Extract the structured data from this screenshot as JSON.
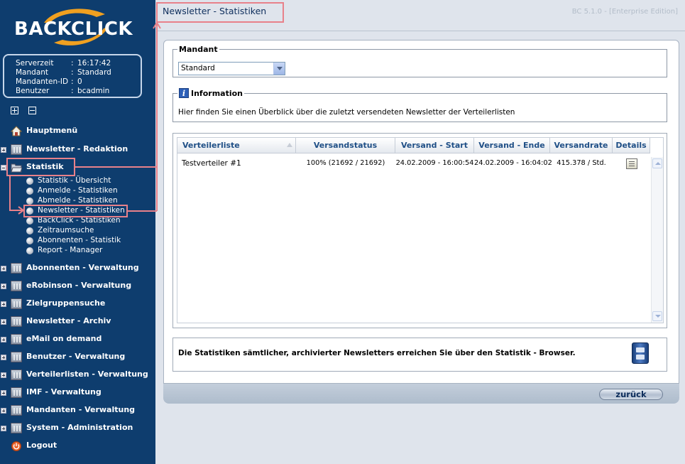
{
  "app": {
    "logo_text": "BACKCLICK",
    "version": "BC 5.1.0 - [Enterprise Edition]"
  },
  "server_info": [
    {
      "key": "Serverzeit",
      "value": "16:17:42"
    },
    {
      "key": "Mandant",
      "value": "Standard"
    },
    {
      "key": "Mandanten-ID",
      "value": "0"
    },
    {
      "key": "Benutzer",
      "value": "bcadmin"
    }
  ],
  "nav": {
    "hauptmenu": "Hauptmenü",
    "newsletter_redaktion": "Newsletter - Redaktion",
    "statistik": "Statistik",
    "statistik_sub": [
      "Statistik - Übersicht",
      "Anmelde - Statistiken",
      "Abmelde - Statistiken",
      "Newsletter - Statistiken",
      "BackClick - Statistiken",
      "Zeitraumsuche",
      "Abonnenten - Statistik",
      "Report - Manager"
    ],
    "abonnenten": "Abonnenten - Verwaltung",
    "erobinson": "eRobinson - Verwaltung",
    "zielgruppensuche": "Zielgruppensuche",
    "newsletter_archiv": "Newsletter - Archiv",
    "email_on_demand": "eMail on demand",
    "benutzer": "Benutzer - Verwaltung",
    "verteilerlisten": "Verteilerlisten - Verwaltung",
    "imf": "IMF - Verwaltung",
    "mandanten": "Mandanten - Verwaltung",
    "system": "System - Administration",
    "logout": "Logout"
  },
  "page": {
    "title": "Newsletter - Statistiken",
    "mandant_legend": "Mandant",
    "mandant_selected": "Standard",
    "info_legend": "Information",
    "info_text": "Hier finden Sie einen Überblick über die zuletzt versendeten Newsletter der Verteilerlisten",
    "browser_text": "Die Statistiken sämtlicher, archivierter Newsletters erreichen Sie über den Statistik - Browser.",
    "back_button": "zurück"
  },
  "table": {
    "columns": [
      "Verteilerliste",
      "Versandstatus",
      "Versand - Start",
      "Versand - Ende",
      "Versandrate",
      "Details"
    ],
    "rows": [
      [
        "Testverteiler #1",
        "100% (21692 / 21692)",
        "24.02.2009 - 16:00:54",
        "24.02.2009 - 16:04:02",
        "415.378 / Std."
      ]
    ]
  },
  "colors": {
    "sidebar": "#0e3d6e",
    "accent_orange": "#f0a020",
    "annotation": "#e8818a",
    "header_text": "#1f4f86"
  },
  "icons": {
    "home": "home-icon",
    "folder": "folder-icon",
    "logout": "power-icon",
    "info": "info-icon",
    "details": "report-icon",
    "browser": "cabinet-icon"
  }
}
